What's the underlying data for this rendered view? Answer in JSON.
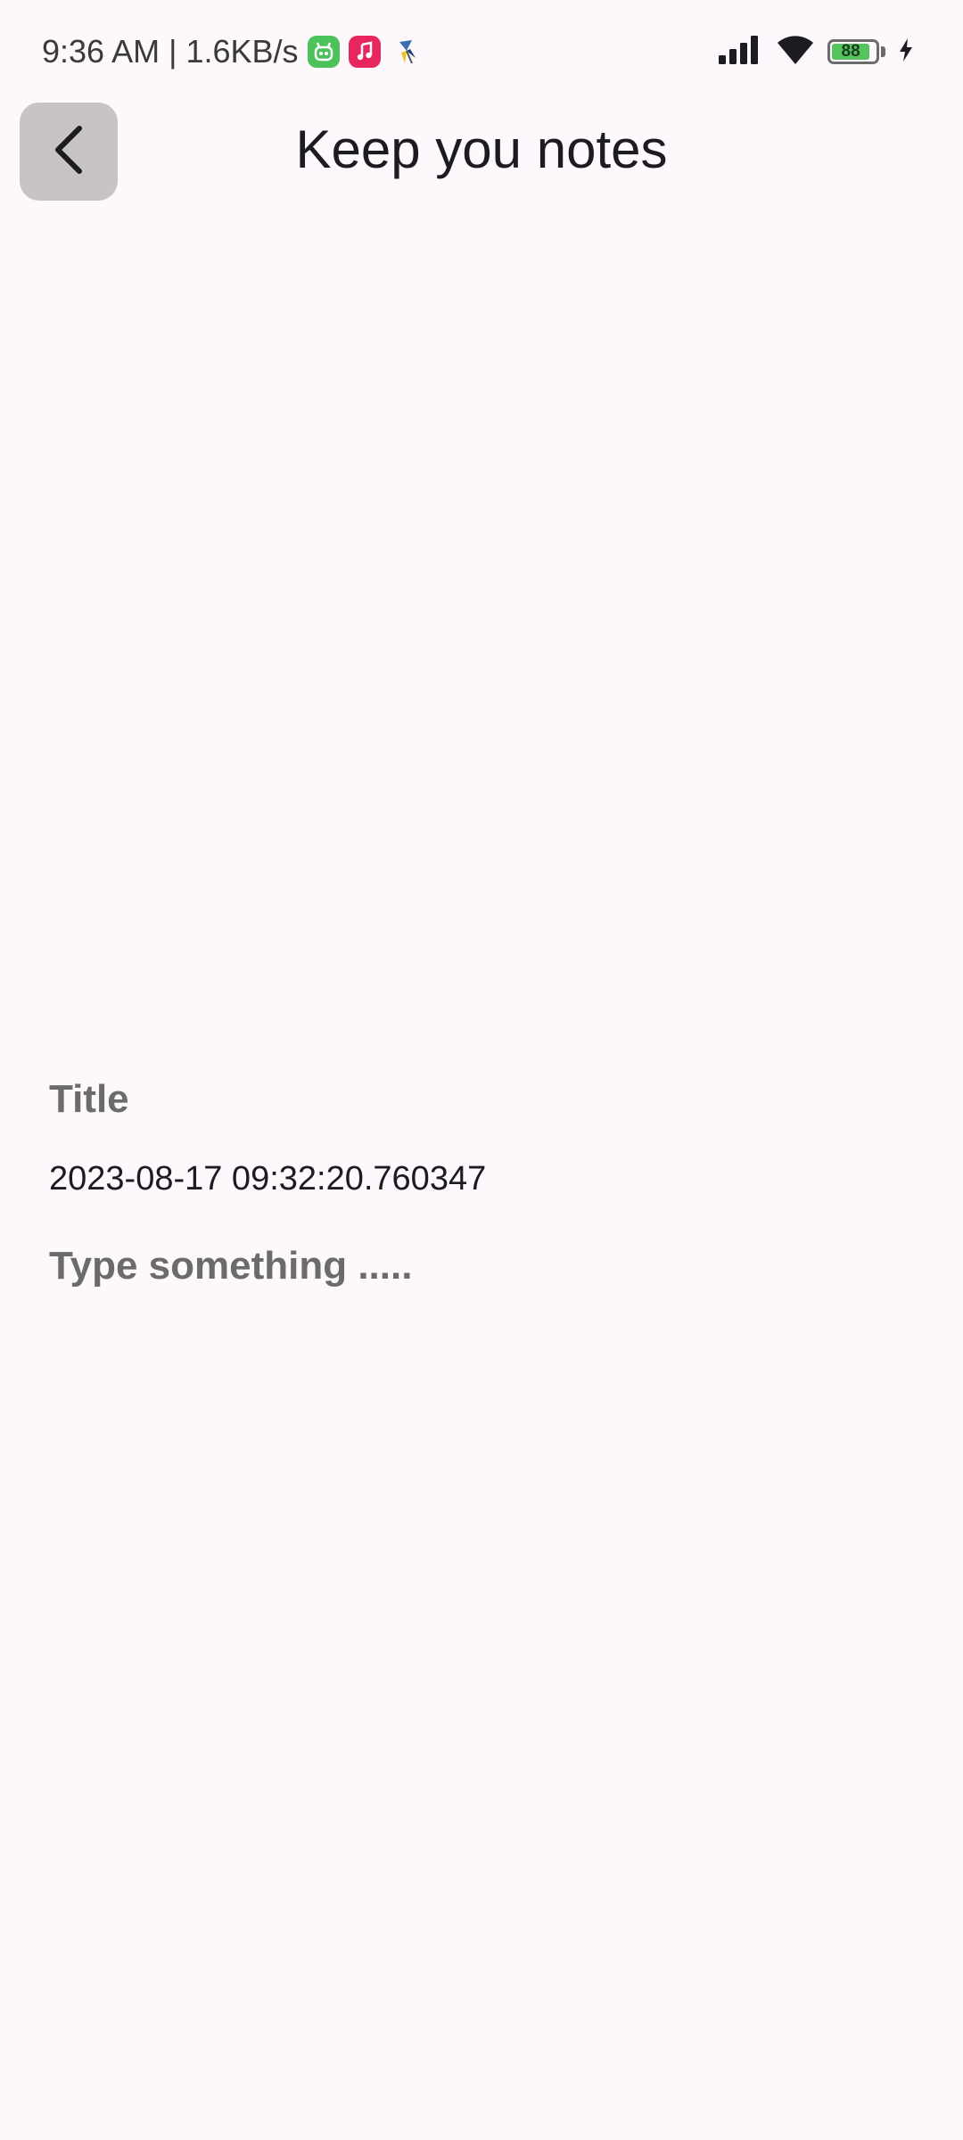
{
  "status_bar": {
    "time": "9:36 AM",
    "separator": "|",
    "net_speed": "1.6KB/s",
    "battery_level": "88",
    "battery_fraction": 0.88,
    "icons": [
      "robot-app-icon",
      "music-app-icon",
      "pinwheel-app-icon",
      "signal-icon",
      "wifi-icon",
      "battery-icon",
      "charging-bolt-icon"
    ],
    "colors": {
      "robot_app": "#4cc25a",
      "music_app": "#e8265e",
      "battery_fill": "#55c45f"
    }
  },
  "header": {
    "back_icon": "chevron-left-icon",
    "title": "Keep you notes"
  },
  "note": {
    "title_placeholder": "Title",
    "timestamp": "2023-08-17 09:32:20.760347",
    "body_placeholder": "Type something ....."
  },
  "colors": {
    "background": "#fdf8fc",
    "back_button_bg": "#c8c4c4",
    "placeholder_text": "#6b6b6b"
  }
}
